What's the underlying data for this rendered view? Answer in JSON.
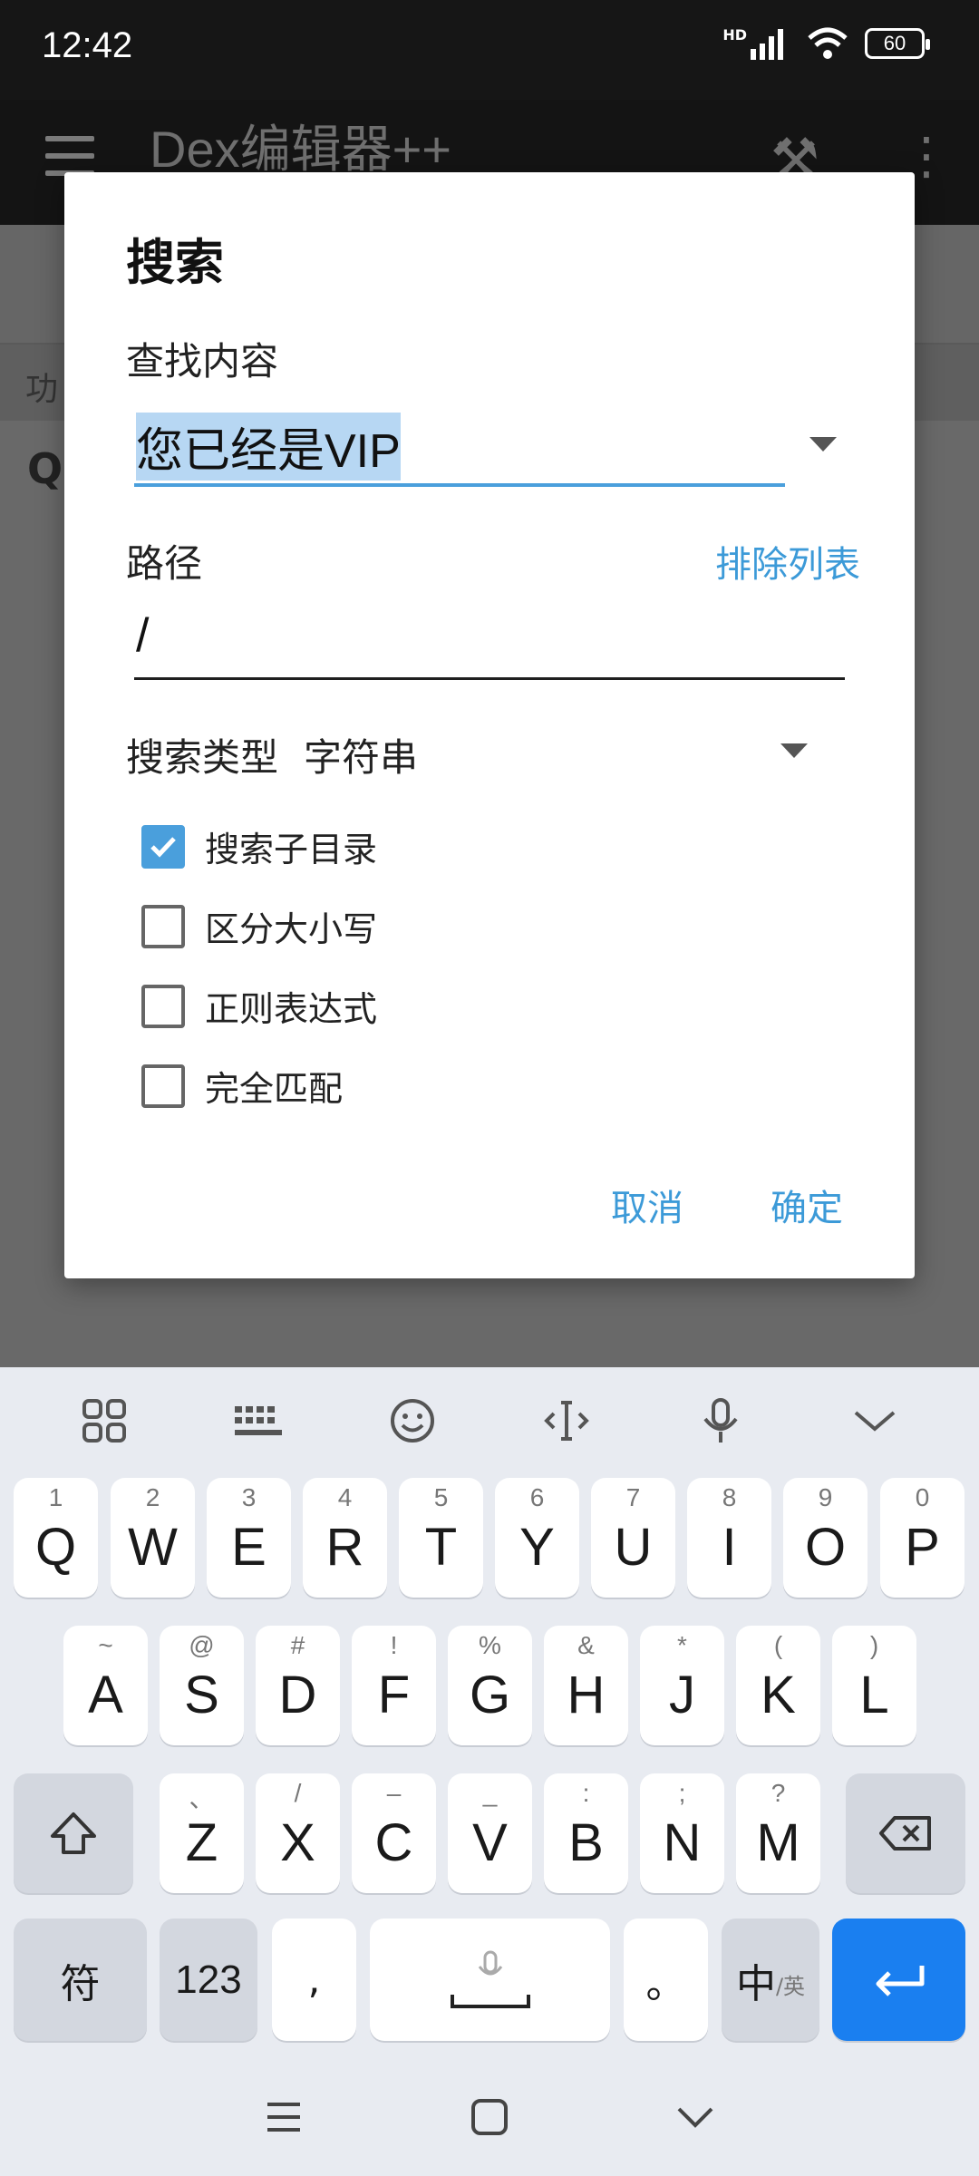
{
  "status": {
    "time": "12:42",
    "battery": "60",
    "network": "HD"
  },
  "appbar": {
    "title": "Dex编辑器++"
  },
  "background": {
    "row_label": "功",
    "q_text": "Q"
  },
  "dialog": {
    "title": "搜索",
    "find_label": "查找内容",
    "find_value": "您已经是VIP",
    "path_label": "路径",
    "exclude_link": "排除列表",
    "path_value": "/",
    "search_type_label": "搜索类型",
    "search_type_value": "字符串",
    "checkboxes": [
      {
        "label": "搜索子目录",
        "checked": true
      },
      {
        "label": "区分大小写",
        "checked": false
      },
      {
        "label": "正则表达式",
        "checked": false
      },
      {
        "label": "完全匹配",
        "checked": false
      }
    ],
    "cancel": "取消",
    "ok": "确定"
  },
  "keyboard": {
    "row1": [
      {
        "k": "Q",
        "s": "1"
      },
      {
        "k": "W",
        "s": "2"
      },
      {
        "k": "E",
        "s": "3"
      },
      {
        "k": "R",
        "s": "4"
      },
      {
        "k": "T",
        "s": "5"
      },
      {
        "k": "Y",
        "s": "6"
      },
      {
        "k": "U",
        "s": "7"
      },
      {
        "k": "I",
        "s": "8"
      },
      {
        "k": "O",
        "s": "9"
      },
      {
        "k": "P",
        "s": "0"
      }
    ],
    "row2": [
      {
        "k": "A",
        "s": "~"
      },
      {
        "k": "S",
        "s": "@"
      },
      {
        "k": "D",
        "s": "#"
      },
      {
        "k": "F",
        "s": "!"
      },
      {
        "k": "G",
        "s": "%"
      },
      {
        "k": "H",
        "s": "&"
      },
      {
        "k": "J",
        "s": "*"
      },
      {
        "k": "K",
        "s": "("
      },
      {
        "k": "L",
        "s": ")"
      }
    ],
    "row3": [
      {
        "k": "Z",
        "s": "、"
      },
      {
        "k": "X",
        "s": "/"
      },
      {
        "k": "C",
        "s": "–"
      },
      {
        "k": "V",
        "s": "_"
      },
      {
        "k": "B",
        "s": ":"
      },
      {
        "k": "N",
        "s": ";"
      },
      {
        "k": "M",
        "s": "?"
      }
    ],
    "sym": "符",
    "num": "123",
    "comma": ",",
    "period": "。",
    "lang_main": "中",
    "lang_sub": "/英"
  },
  "colors": {
    "accent": "#4a9fdc",
    "enter_key": "#1a7ff0"
  }
}
